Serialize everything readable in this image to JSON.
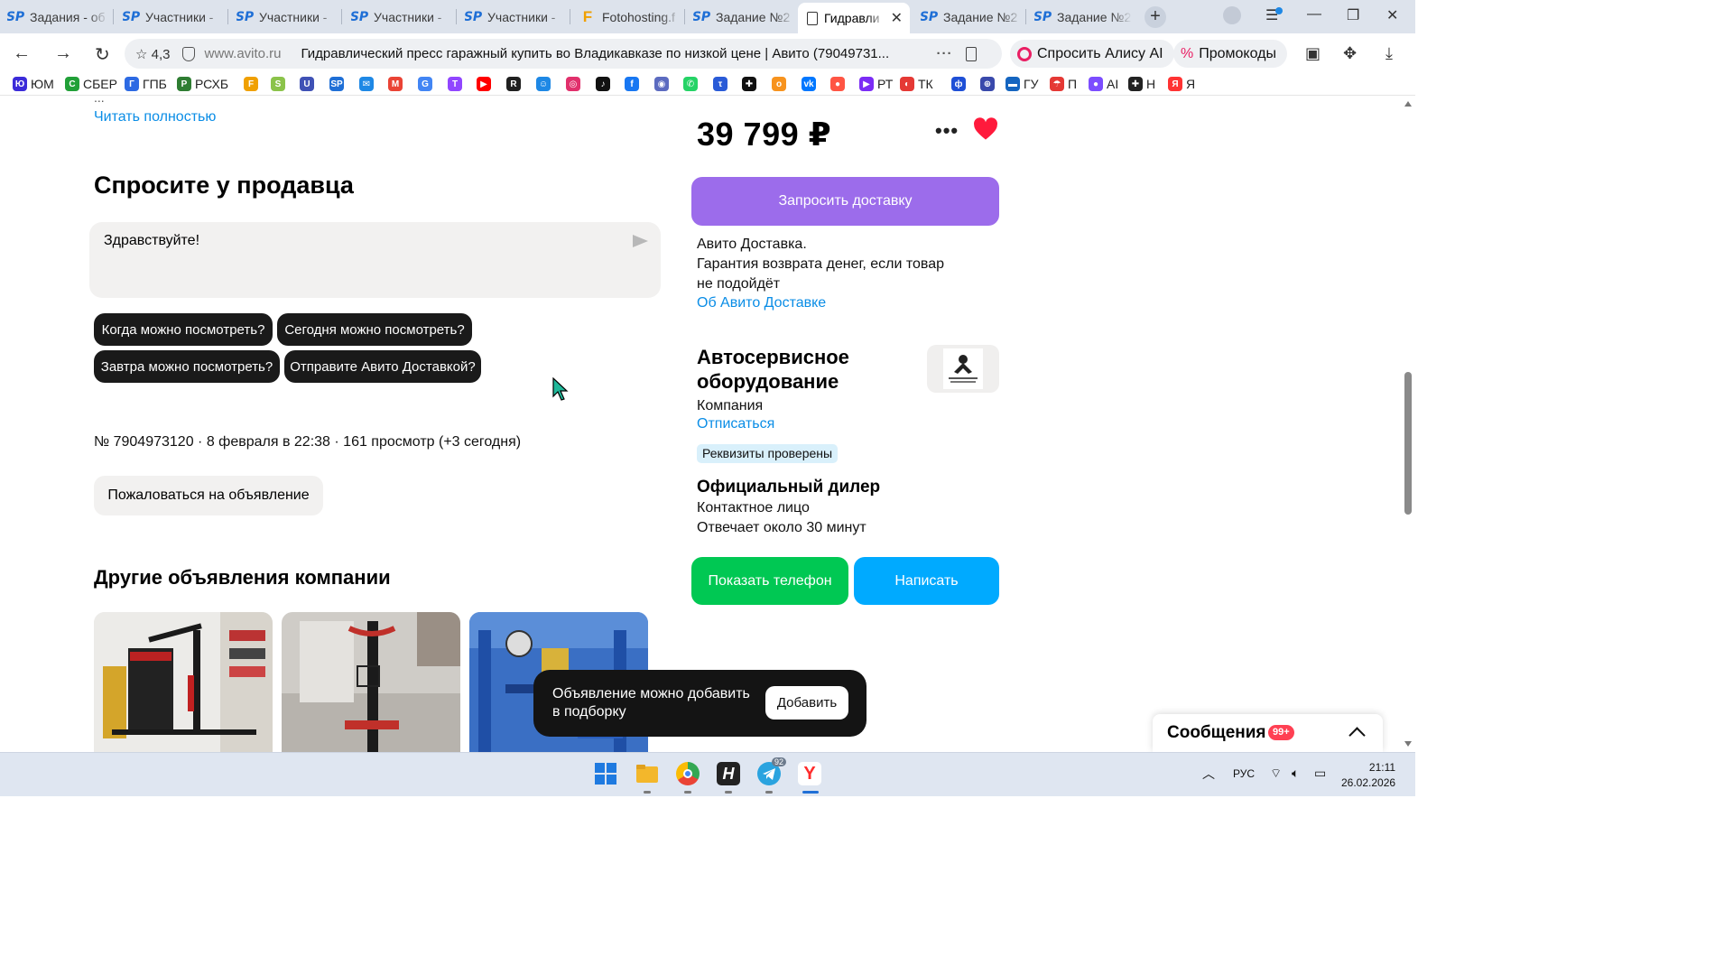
{
  "browser": {
    "tabs": [
      {
        "title": "Задания - об",
        "icon": "sp-icon"
      },
      {
        "title": "Участники - ",
        "icon": "sp-icon"
      },
      {
        "title": "Участники - ",
        "icon": "sp-icon"
      },
      {
        "title": "Участники - ",
        "icon": "sp-icon"
      },
      {
        "title": "Участники - ",
        "icon": "sp-icon"
      },
      {
        "title": "Fotohosting.f",
        "icon": "fotohosting-icon"
      },
      {
        "title": "Задание №2",
        "icon": "sp-icon"
      },
      {
        "title": "Гидравли",
        "icon": "document-icon",
        "active": true
      },
      {
        "title": "Задание №2",
        "icon": "sp-icon"
      },
      {
        "title": "Задание №2",
        "icon": "sp-icon"
      }
    ],
    "address": {
      "rating": "4,3",
      "domain": "www.avito.ru",
      "page_title": "Гидравлический пресс гаражный купить во Владикавказе по низкой цене | Авито (79049731..."
    },
    "alice_label": "Спросить Алису AI",
    "promo_label": "Промокоды",
    "bookmarks": [
      {
        "label": "ЮМ",
        "color": "#3b2bd9",
        "glyph": "Ю"
      },
      {
        "label": "СБЕР",
        "color": "#21a038",
        "glyph": "С"
      },
      {
        "label": "ГПБ",
        "color": "#2d6ae3",
        "glyph": "Г"
      },
      {
        "label": "РСХБ",
        "color": "#2e7d32",
        "glyph": "Р"
      },
      {
        "label": "",
        "color": "#f0a000",
        "glyph": "F"
      },
      {
        "label": "",
        "color": "#8bc34a",
        "glyph": "S"
      },
      {
        "label": "",
        "color": "#3f51b5",
        "glyph": "U"
      },
      {
        "label": "",
        "color": "#1f6fd6",
        "glyph": "SP"
      },
      {
        "label": "",
        "color": "#1e88e5",
        "glyph": "✉"
      },
      {
        "label": "",
        "color": "#ea4335",
        "glyph": "M"
      },
      {
        "label": "",
        "color": "#4285f4",
        "glyph": "G"
      },
      {
        "label": "",
        "color": "#9146ff",
        "glyph": "T"
      },
      {
        "label": "",
        "color": "#ff0000",
        "glyph": "▶"
      },
      {
        "label": "",
        "color": "#202020",
        "glyph": "R"
      },
      {
        "label": "",
        "color": "#1e88e5",
        "glyph": "☺"
      },
      {
        "label": "",
        "color": "#e1306c",
        "glyph": "◎"
      },
      {
        "label": "",
        "color": "#111111",
        "glyph": "♪"
      },
      {
        "label": "",
        "color": "#1877f2",
        "glyph": "f"
      },
      {
        "label": "",
        "color": "#5c6bc0",
        "glyph": "◉"
      },
      {
        "label": "",
        "color": "#25d366",
        "glyph": "✆"
      },
      {
        "label": "",
        "color": "#2a5bd7",
        "glyph": "τ"
      },
      {
        "label": "",
        "color": "#111111",
        "glyph": "✚"
      },
      {
        "label": "",
        "color": "#f7931e",
        "glyph": "o"
      },
      {
        "label": "",
        "color": "#0077ff",
        "glyph": "vk"
      },
      {
        "label": "",
        "color": "#ff5544",
        "glyph": "●"
      },
      {
        "label": "РТ",
        "color": "#7b2cf5",
        "glyph": "▶"
      },
      {
        "label": "ТК",
        "color": "#e53935",
        "glyph": "◐"
      },
      {
        "label": "",
        "color": "#1e4fd6",
        "glyph": "ф"
      },
      {
        "label": "",
        "color": "#3949ab",
        "glyph": "⊕"
      },
      {
        "label": "ГУ",
        "color": "#1565c0",
        "glyph": "▬"
      },
      {
        "label": "П",
        "color": "#e53935",
        "glyph": "☂"
      },
      {
        "label": "AI",
        "color": "#7c4dff",
        "glyph": "●"
      },
      {
        "label": "Н",
        "color": "#222222",
        "glyph": "✚"
      },
      {
        "label": "Я",
        "color": "#ff3333",
        "glyph": "Я"
      }
    ]
  },
  "page": {
    "read_more": "Читать полностью",
    "ask_title": "Спросите у продавца",
    "message_text": "Здравствуйте!",
    "quick_questions": [
      "Когда можно посмотреть?",
      "Сегодня можно посмотреть?",
      "Завтра можно посмотреть?",
      "Отправите Авито Доставкой?"
    ],
    "ad_meta": "№ 7904973120 · 8 февраля в 22:38 · 161 просмотр (+3 сегодня)",
    "complain_label": "Пожаловаться на объявление",
    "other_ads_title": "Другие объявления компании",
    "price": "39 799 ₽",
    "delivery_button": "Запросить доставку",
    "delivery_info": [
      "Авито Доставка.",
      "Гарантия возврата денег, если товар",
      "не подойдёт"
    ],
    "delivery_link": "Об Авито Доставке",
    "seller_name": "Автосервисное оборудование",
    "seller_type": "Компания",
    "unsubscribe": "Отписаться",
    "verified_badge": "Реквизиты проверены",
    "dealer_title": "Официальный дилер",
    "contact_person": "Контактное лицо",
    "response_time": "Отвечает около 30 минут",
    "phone_button": "Показать телефон",
    "write_button": "Написать",
    "toast_text": "Объявление можно добавить в подборку",
    "toast_button": "Добавить",
    "messages_label": "Сообщения",
    "messages_count": "99+"
  },
  "taskbar": {
    "language": "РУС",
    "time": "21:11",
    "date": "26.02.2026",
    "telegram_badge": "92"
  },
  "colors": {
    "delivery_purple": "#9c6ceb",
    "phone_green": "#00c853",
    "write_blue": "#00aaff",
    "link_blue": "#0a8de6",
    "heart_red": "#ff1a3c"
  }
}
